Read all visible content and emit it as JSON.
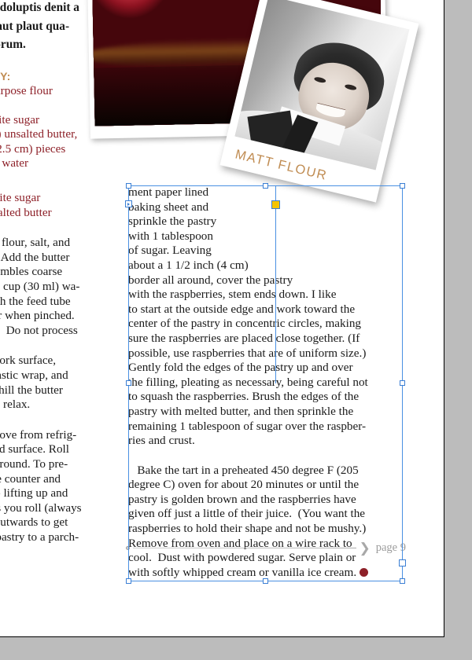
{
  "document": {
    "page_label": "page 9",
    "chevron_glyph": "❯",
    "canvas_bg": "#bcbcbc",
    "page_bg": "#ffffff"
  },
  "left_column": {
    "lede": "r as doluptis denit a\nitis aut plaut qua-\nmporum.",
    "section_heading": "STRY:",
    "ingredients_a": "ll-purpose flour\nsalt\n  white sugar\nams) unsalted butter,\nch (2.5 cm) pieces\n) ice water",
    "ingredients_b": ") white sugar\n unsalted butter",
    "paragraph_1": "  the flour, salt, and\nned. Add the butter\n resembles coarse\nr 1/8 cup (30 ml) wa-\nrough the feed tube\nether when pinched.\nsary.  Do not process",
    "paragraph_2": "ur work surface,\nn plastic wrap, and\n to chill the butter\nur to relax.",
    "paragraph_3": " remove from refrig-\noured surface. Roll\ncm) round. To pre-\no the counter and\nkeep lifting up and\nrn as you roll (always\ntry outwards to get\nthe pastry to a parch-"
  },
  "right_column": {
    "paragraph_1": "ment paper lined\nbaking sheet and\nsprinkle the pastry\nwith 1 tablespoon\nof sugar. Leaving\nabout a 1 1/2 inch (4 cm)\nborder all around, cover the pastry\nwith the raspberries, stem ends down. I like\nto start at the outside edge and work toward the\ncenter of the pastry in concentric circles, making\nsure the raspberries are placed close together. (If\npossible, use raspberries that are of uniform size.)\nGently fold the edges of the pastry up and over\nthe filling, pleating as necessary, being careful not\nto squash the raspberries. Brush the edges of the\npastry with melted butter, and then sprinkle the\nremaining 1 tablespoon of sugar over the raspber-\nries and crust.",
    "paragraph_2": "   Bake the tart in a preheated 450 degree F (205\ndegree C) oven for about 20 minutes or until the\npastry is golden brown and the raspberries have\ngiven off just a little of their juice.  (You want the\nraspberries to hold their shape and not be mushy.)\nRemove from oven and place on a wire rack to\ncool.  Dust with powdered sugar. Serve plain or\nwith softly whipped cream or vanilla ice cream."
  },
  "photos": {
    "berries_alt": "raspberries-photo",
    "portrait_alt": "portrait-photo",
    "portrait_caption": "MATT FLOUR"
  },
  "colors": {
    "accent_tan": "#c08c52",
    "accent_red": "#8d2028",
    "selection_blue": "#4a90e2",
    "corner_handle_yellow": "#f5c400"
  }
}
